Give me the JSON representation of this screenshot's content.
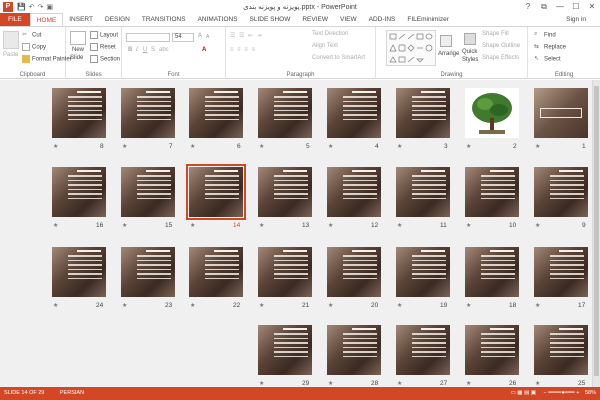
{
  "titlebar": {
    "app_icon": "P",
    "title": "پویزنه و پویزنه بندی.pptx - PowerPoint",
    "qat": [
      "save-icon",
      "undo-icon",
      "redo-icon",
      "present-icon"
    ],
    "help": "?",
    "restore": "⧉",
    "minimize": "—",
    "maximize": "☐",
    "close": "✕"
  },
  "tabs": [
    "FILE",
    "HOME",
    "INSERT",
    "DESIGN",
    "TRANSITIONS",
    "ANIMATIONS",
    "SLIDE SHOW",
    "REVIEW",
    "VIEW",
    "ADD-INS",
    "FILEminimizer"
  ],
  "sign_in": "Sign in",
  "ribbon": {
    "clipboard": {
      "label": "Clipboard",
      "paste": "Paste",
      "cut": "Cut",
      "copy": "Copy",
      "format_painter": "Format Painter"
    },
    "slides": {
      "label": "Slides",
      "new_slide": "New",
      "new_slide2": "Slide",
      "layout": "Layout",
      "reset": "Reset",
      "section": "Section"
    },
    "font": {
      "label": "Font",
      "size": "54"
    },
    "paragraph": {
      "label": "Paragraph",
      "text_direction": "Text Direction",
      "align_text": "Align Text",
      "convert_smartart": "Convert to SmartArt"
    },
    "drawing": {
      "label": "Drawing",
      "arrange": "Arrange",
      "quick_styles": "Quick",
      "quick_styles2": "Styles",
      "shape_fill": "Shape Fill",
      "shape_outline": "Shape Outline",
      "shape_effects": "Shape Effects"
    },
    "editing": {
      "label": "Editing",
      "find": "Find",
      "replace": "Replace",
      "select": "Select"
    }
  },
  "slides": [
    {
      "n": "8"
    },
    {
      "n": "7"
    },
    {
      "n": "6"
    },
    {
      "n": "5"
    },
    {
      "n": "4"
    },
    {
      "n": "3"
    },
    {
      "n": "2"
    },
    {
      "n": "1"
    },
    {
      "n": "16"
    },
    {
      "n": "15"
    },
    {
      "n": "14"
    },
    {
      "n": "13"
    },
    {
      "n": "12"
    },
    {
      "n": "11"
    },
    {
      "n": "10"
    },
    {
      "n": "9"
    },
    {
      "n": "24"
    },
    {
      "n": "23"
    },
    {
      "n": "22"
    },
    {
      "n": "21"
    },
    {
      "n": "20"
    },
    {
      "n": "19"
    },
    {
      "n": "18"
    },
    {
      "n": "17"
    },
    {
      "n": "29"
    },
    {
      "n": "28"
    },
    {
      "n": "27"
    },
    {
      "n": "26"
    },
    {
      "n": "25"
    }
  ],
  "selected_slide": "14",
  "star": "★",
  "status": {
    "slide_of": "SLIDE 14 OF 29",
    "language": "PERSIAN",
    "zoom": "58%"
  }
}
